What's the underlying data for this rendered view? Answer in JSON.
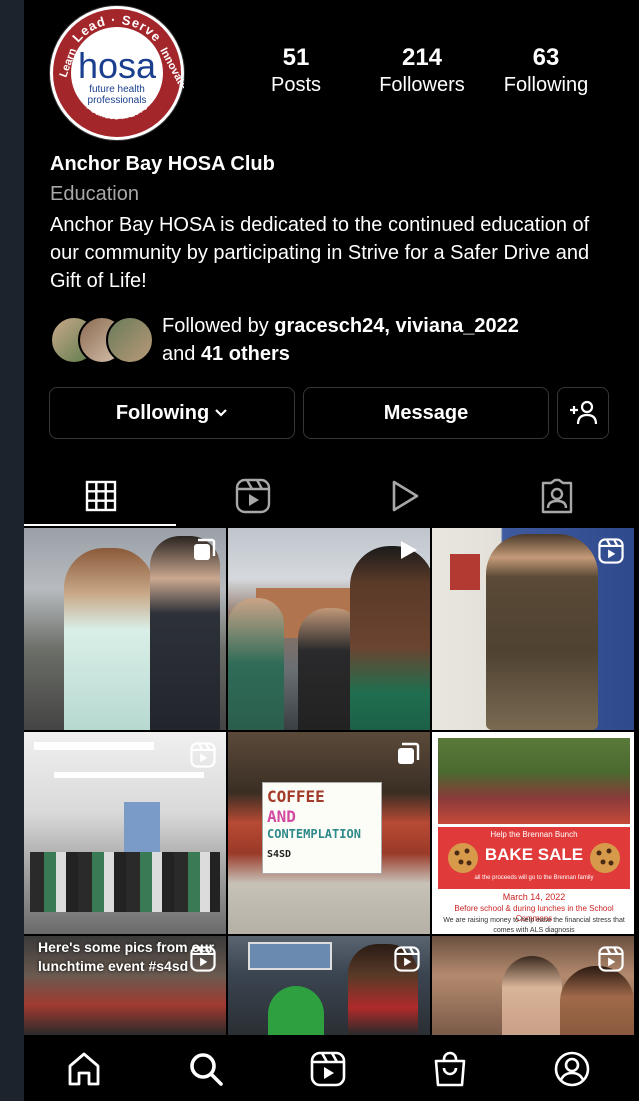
{
  "profile": {
    "name": "Anchor Bay HOSA Club",
    "category": "Education",
    "bio": "Anchor Bay HOSA is dedicated to the continued education of our community by participating in Strive for a Safer Drive and Gift of Life!",
    "avatar_logo": {
      "top_arc": "Lead · Serve",
      "left_arc": "Learn",
      "right_arc": "Innovate",
      "wordmark": "hosa",
      "tagline1": "future health",
      "tagline2": "professionals",
      "bottom_arc": "Founded in 1976"
    }
  },
  "stats": [
    {
      "value": "51",
      "label": "Posts"
    },
    {
      "value": "214",
      "label": "Followers"
    },
    {
      "value": "63",
      "label": "Following"
    }
  ],
  "followed_by": {
    "prefix": "Followed by ",
    "user1": "gracesch24",
    "separator": ", ",
    "user2": "viviana_2022",
    "and_text": "and ",
    "others": "41 others"
  },
  "actions": {
    "following_label": "Following",
    "message_label": "Message"
  },
  "tabs": [
    "grid-icon",
    "reels-icon",
    "video-icon",
    "tagged-icon"
  ],
  "posts": [
    {
      "badge": "carousel-icon"
    },
    {
      "badge": "play-icon"
    },
    {
      "badge": "reel-icon"
    },
    {
      "badge": "reel-icon"
    },
    {
      "badge": "carousel-icon",
      "sign_line1": "COFFEE",
      "sign_line2": "AND",
      "sign_line3": "CONTEMPLATION",
      "sign_tag": "S4SD"
    },
    {
      "banner_top": "Help the Brennan Bunch",
      "banner_title": "BAKE SALE",
      "banner_sub": "all the proceeds will go to the Brennan family",
      "date": "March 14, 2022",
      "when": "Before school & during lunches in the School Commons",
      "note": "We are raising money to help ease the financial stress that comes with ALS diagnosis"
    },
    {
      "badge": "reel-icon",
      "caption": "Here's some pics from our lunchtime event #s4sd"
    },
    {
      "badge": "reel-icon"
    },
    {
      "badge": "reel-icon"
    }
  ],
  "bottom_nav": [
    "home-icon",
    "search-icon",
    "reels-icon",
    "shop-icon",
    "profile-icon"
  ],
  "colors": {
    "background": "#000000",
    "secondary_text": "#a8a8a8",
    "button_border": "#363636",
    "frame": "#1c232c"
  }
}
